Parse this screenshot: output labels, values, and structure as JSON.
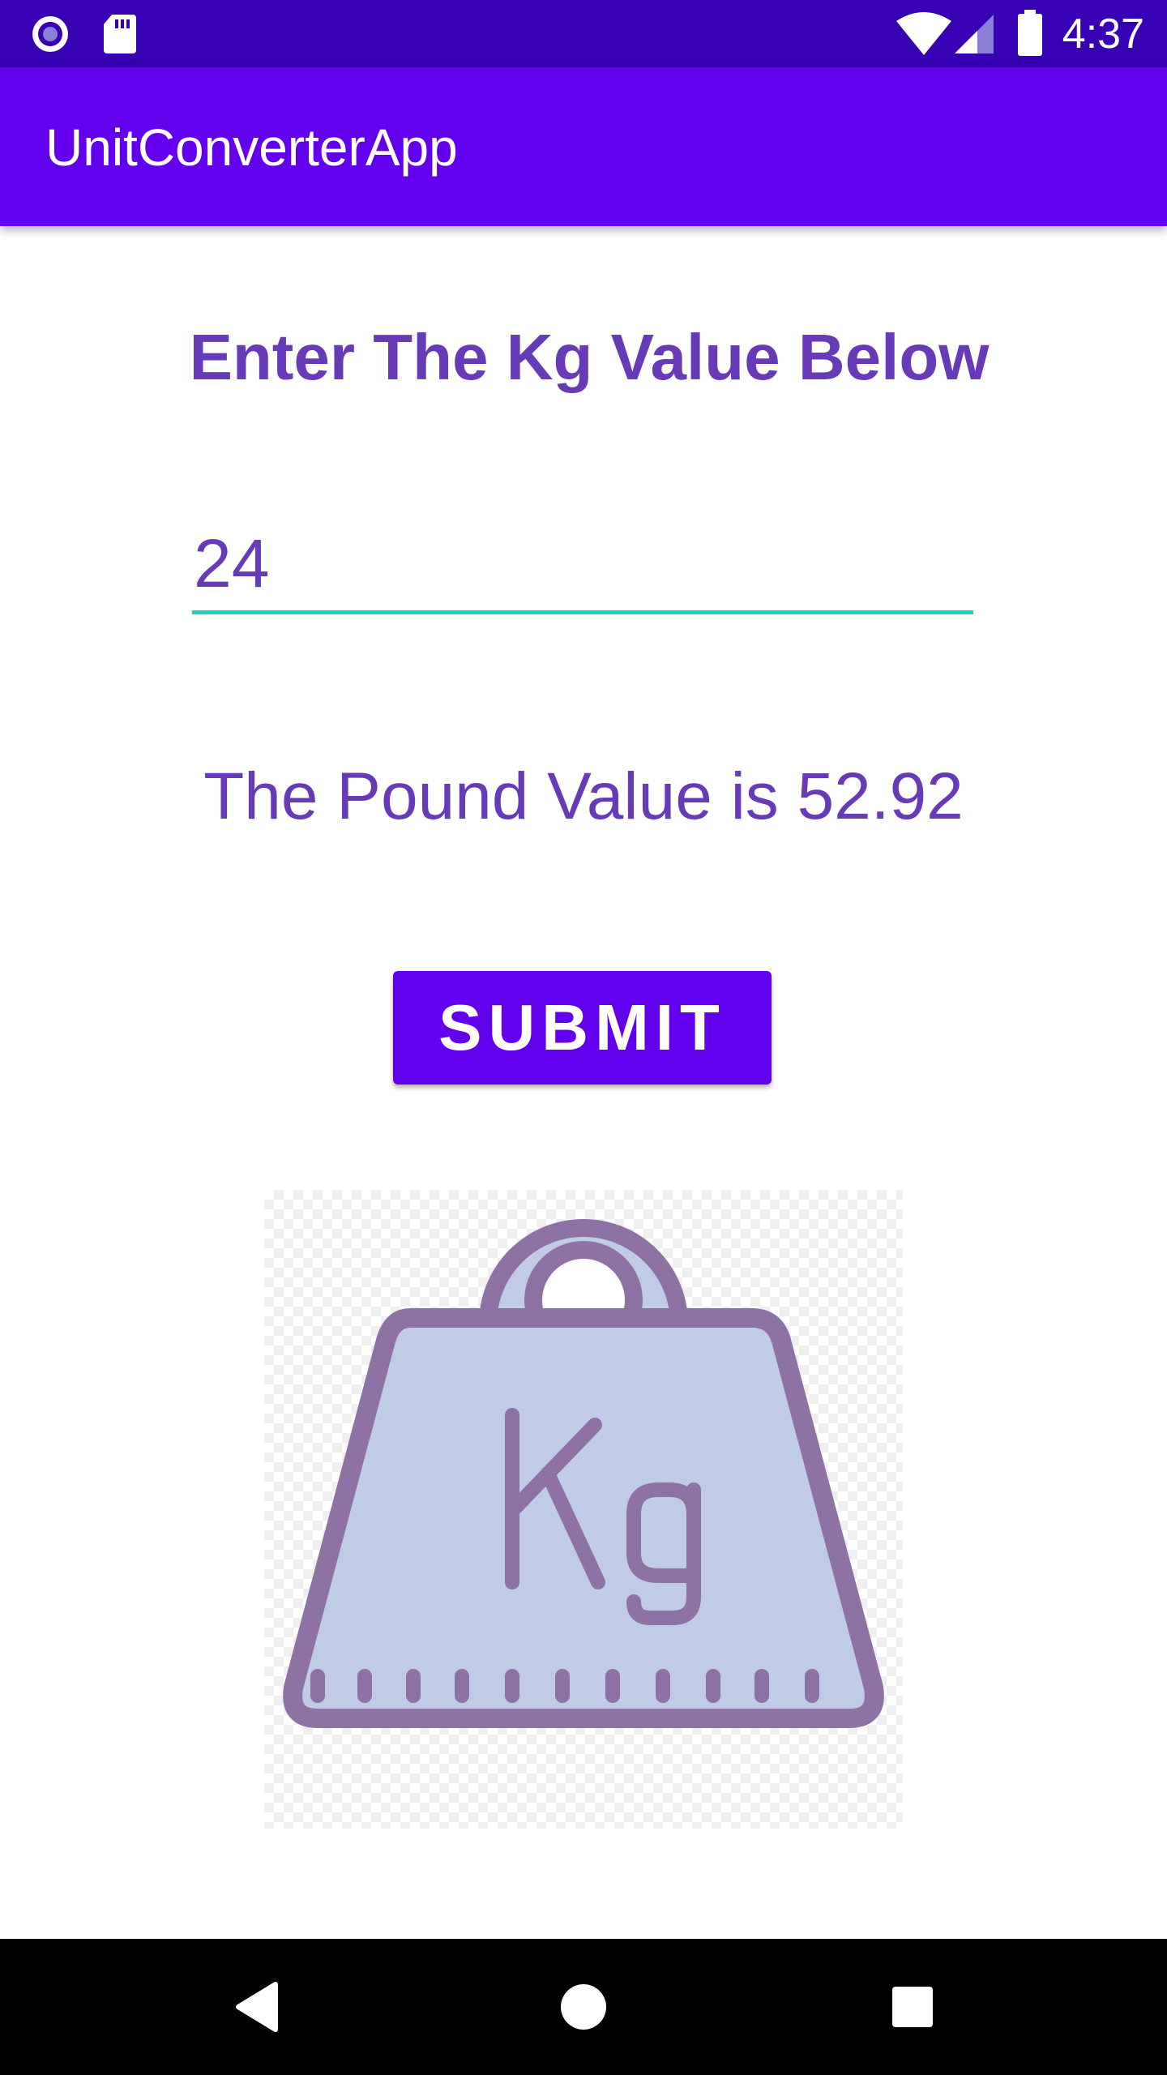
{
  "status_bar": {
    "time": "4:37",
    "icons_left": [
      "record-indicator-icon",
      "sd-card-icon"
    ],
    "icons_right": [
      "wifi-icon",
      "signal-icon",
      "battery-icon"
    ]
  },
  "app_bar": {
    "title": "UnitConverterApp"
  },
  "main": {
    "heading": "Enter The Kg Value Below",
    "kg_input_value": "24",
    "result_text": "The Pound Value is 52.92",
    "submit_label": "SUBMIT",
    "image": {
      "icon": "kg-weight-icon",
      "label": "Kg"
    }
  },
  "nav_bar": {
    "buttons": [
      "back-icon",
      "home-icon",
      "recents-icon"
    ]
  },
  "colors": {
    "status_bar": "#3700b3",
    "app_bar": "#6200ee",
    "text_accent": "#673ab7",
    "input_underline": "#1fd1c2",
    "weight_fill": "#c0cbe5",
    "weight_stroke": "#8e72a4"
  }
}
